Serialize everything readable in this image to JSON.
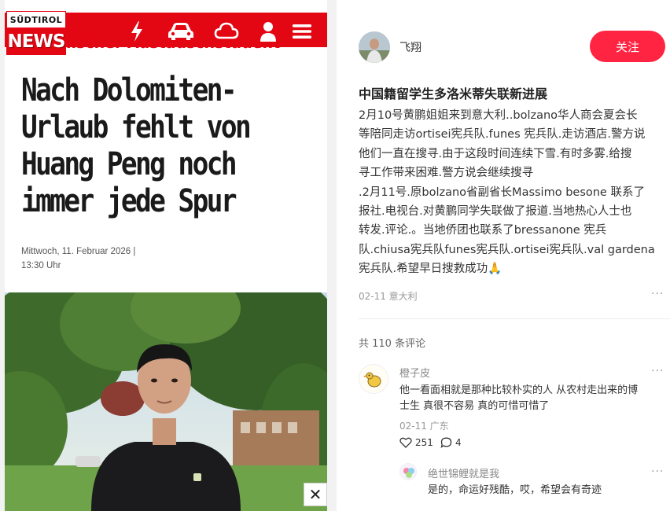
{
  "news": {
    "logo_top": "SÜDTIROL",
    "logo_bottom": "NEWS",
    "nav_icons": [
      "lightning-icon",
      "car-icon",
      "cloud-icon",
      "user-icon",
      "menu-icon"
    ],
    "kicker": "lischer Austauschstudent",
    "headline_lines": [
      "Nach Dolomiten-",
      "Urlaub fehlt von",
      "Huang Peng noch",
      "immer jede Spur"
    ],
    "date_line1": "Mittwoch, 11. Februar 2026 |",
    "date_line2": "13:30 Uhr",
    "close_glyph": "✕",
    "colors": {
      "brand_red": "#e30613"
    }
  },
  "post": {
    "author": "飞翔",
    "follow_label": "关注",
    "title": "中国籍留学生多洛米蒂失联新进展",
    "body_lines": [
      "2月10号黄鹏姐姐来到意大利..bolzano华人商会夏会长",
      "等陪同走访ortisei宪兵队.funes 宪兵队.走访酒店.警方说",
      "他们一直在搜寻.由于这段时间连续下雪.有时多雾.给搜",
      "寻工作带来困难.警方说会继续搜寻",
      ".2月11号.原bolzano省副省长Massimo besone 联系了",
      "报社.电视台.对黄鹏同学失联做了报道.当地热心人士也",
      "转发.评论.。当地侨团也联系了bressanone 宪兵",
      "队.chiusa宪兵队funes宪兵队.ortisei宪兵队.val gardena",
      "宪兵队.希望早日搜救成功🙏"
    ],
    "meta": "02-11 意大利",
    "more_glyph": "···",
    "comment_count": "共 110 条评论",
    "colors": {
      "follow_bg": "#ff2442"
    }
  },
  "comments": [
    {
      "user": "橙子皮",
      "text_lines": [
        "他一看面相就是那种比较朴实的人 从农村走出来的博",
        "士生 真很不容易 真的可惜可惜了"
      ],
      "meta": "02-11 广东",
      "likes": "251",
      "replies": "4"
    },
    {
      "user": "绝世锦鲤就是我",
      "text_lines": [
        "是的，命运好残酷，哎，希望会有奇迹"
      ]
    }
  ]
}
